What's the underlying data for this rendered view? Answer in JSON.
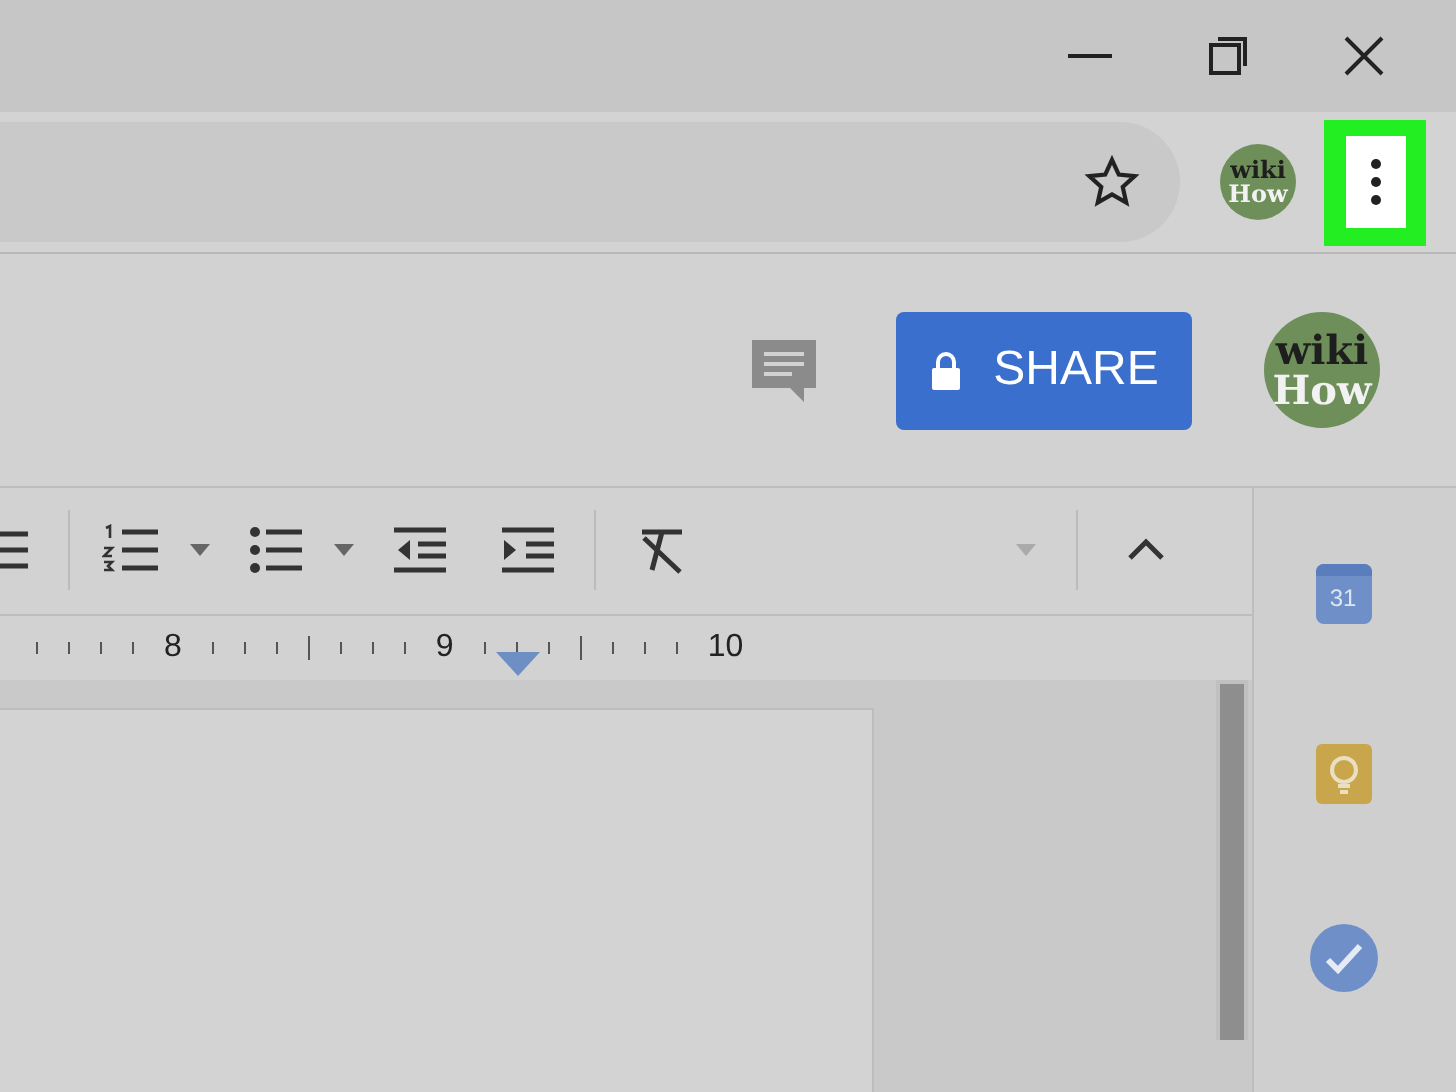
{
  "browser": {
    "menu_button": {
      "highlighted": true
    },
    "profile_avatar": {
      "line_1": "wiki",
      "line_2": "How"
    }
  },
  "docs_header": {
    "share_button": "SHARE",
    "account_avatar": {
      "line_1": "wiki",
      "line_2": "How"
    }
  },
  "ruler": {
    "labels": [
      "8",
      "9",
      "10"
    ]
  },
  "side_panel": {
    "calendar_day": "31"
  }
}
